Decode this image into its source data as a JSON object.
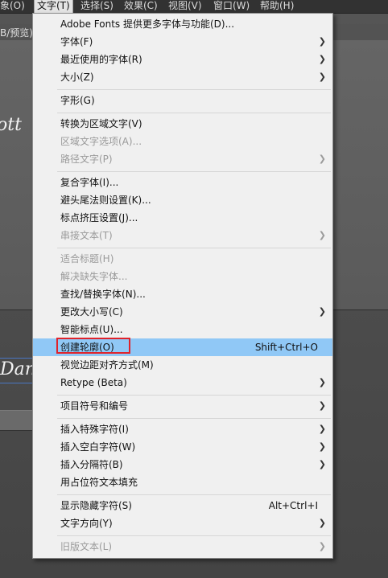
{
  "menubar": {
    "items": [
      {
        "label": "象(O)",
        "active": false
      },
      {
        "label": "文字(T)",
        "active": true
      },
      {
        "label": "选择(S)",
        "active": false
      },
      {
        "label": "效果(C)",
        "active": false
      },
      {
        "label": "视图(V)",
        "active": false
      },
      {
        "label": "窗口(W)",
        "active": false
      },
      {
        "label": "帮助(H)",
        "active": false
      }
    ]
  },
  "document": {
    "tab_text": "B/预览)",
    "script_text_1": "ott",
    "script_text_2": "Dan"
  },
  "menu": {
    "highlight_color": "#90c8f6",
    "items": [
      {
        "label": "Adobe Fonts 提供更多字体与功能(D)...",
        "enabled": true,
        "submenu": false,
        "shortcut": ""
      },
      {
        "label": "字体(F)",
        "enabled": true,
        "submenu": true,
        "shortcut": ""
      },
      {
        "label": "最近使用的字体(R)",
        "enabled": true,
        "submenu": true,
        "shortcut": ""
      },
      {
        "label": "大小(Z)",
        "enabled": true,
        "submenu": true,
        "shortcut": ""
      },
      {
        "label": "字形(G)",
        "enabled": true,
        "submenu": false,
        "shortcut": ""
      },
      {
        "label": "转换为区域文字(V)",
        "enabled": true,
        "submenu": false,
        "shortcut": ""
      },
      {
        "label": "区域文字选项(A)...",
        "enabled": false,
        "submenu": false,
        "shortcut": ""
      },
      {
        "label": "路径文字(P)",
        "enabled": false,
        "submenu": true,
        "shortcut": ""
      },
      {
        "label": "复合字体(I)...",
        "enabled": true,
        "submenu": false,
        "shortcut": ""
      },
      {
        "label": "避头尾法则设置(K)...",
        "enabled": true,
        "submenu": false,
        "shortcut": ""
      },
      {
        "label": "标点挤压设置(J)...",
        "enabled": true,
        "submenu": false,
        "shortcut": ""
      },
      {
        "label": "串接文本(T)",
        "enabled": false,
        "submenu": true,
        "shortcut": ""
      },
      {
        "label": "适合标题(H)",
        "enabled": false,
        "submenu": false,
        "shortcut": ""
      },
      {
        "label": "解决缺失字体...",
        "enabled": false,
        "submenu": false,
        "shortcut": ""
      },
      {
        "label": "查找/替换字体(N)...",
        "enabled": true,
        "submenu": false,
        "shortcut": ""
      },
      {
        "label": "更改大小写(C)",
        "enabled": true,
        "submenu": true,
        "shortcut": ""
      },
      {
        "label": "智能标点(U)...",
        "enabled": true,
        "submenu": false,
        "shortcut": ""
      },
      {
        "label": "创建轮廓(O)",
        "enabled": true,
        "submenu": false,
        "shortcut": "Shift+Ctrl+O",
        "highlighted": true
      },
      {
        "label": "视觉边距对齐方式(M)",
        "enabled": true,
        "submenu": false,
        "shortcut": ""
      },
      {
        "label": "Retype (Beta)",
        "enabled": true,
        "submenu": true,
        "shortcut": ""
      },
      {
        "label": "项目符号和编号",
        "enabled": true,
        "submenu": true,
        "shortcut": ""
      },
      {
        "label": "插入特殊字符(I)",
        "enabled": true,
        "submenu": true,
        "shortcut": ""
      },
      {
        "label": "插入空白字符(W)",
        "enabled": true,
        "submenu": true,
        "shortcut": ""
      },
      {
        "label": "插入分隔符(B)",
        "enabled": true,
        "submenu": true,
        "shortcut": ""
      },
      {
        "label": "用占位符文本填充",
        "enabled": true,
        "submenu": false,
        "shortcut": ""
      },
      {
        "label": "显示隐藏字符(S)",
        "enabled": true,
        "submenu": false,
        "shortcut": "Alt+Ctrl+I"
      },
      {
        "label": "文字方向(Y)",
        "enabled": true,
        "submenu": true,
        "shortcut": ""
      },
      {
        "label": "旧版文本(L)",
        "enabled": false,
        "submenu": true,
        "shortcut": ""
      }
    ]
  }
}
